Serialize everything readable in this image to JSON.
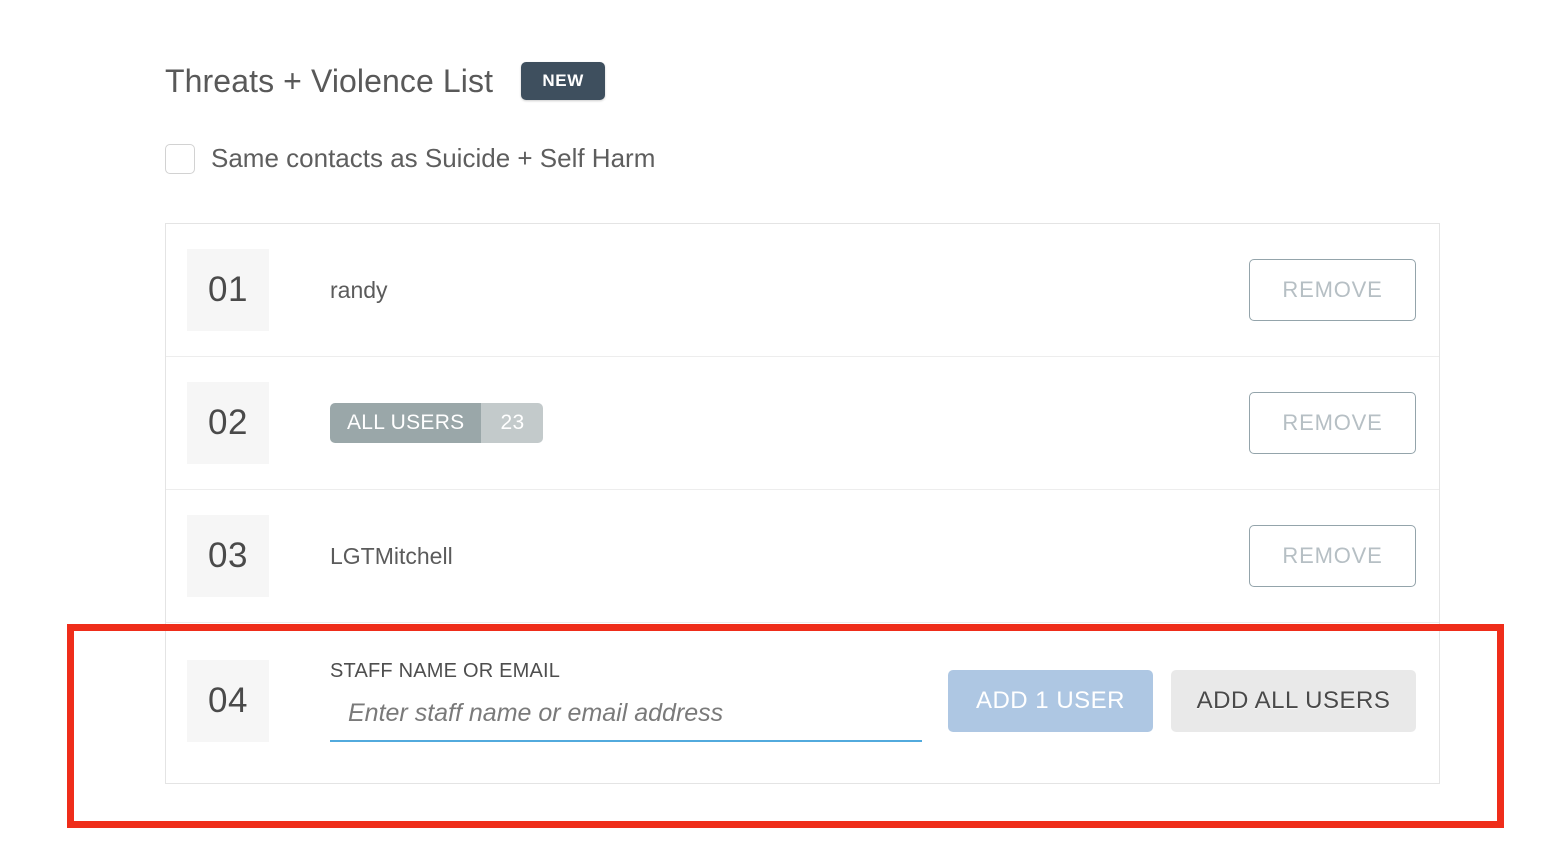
{
  "header": {
    "title": "Threats + Violence List",
    "badge": "NEW"
  },
  "same_contacts": {
    "label": "Same contacts as Suicide + Self Harm",
    "checked": false
  },
  "list": {
    "rows": [
      {
        "index": "01",
        "type": "user",
        "name": "randy",
        "action_label": "REMOVE"
      },
      {
        "index": "02",
        "type": "group",
        "pill_label": "ALL USERS",
        "pill_count": "23",
        "action_label": "REMOVE"
      },
      {
        "index": "03",
        "type": "user",
        "name": "LGTMitchell",
        "action_label": "REMOVE"
      },
      {
        "index": "04",
        "type": "input",
        "field_label": "STAFF NAME OR EMAIL",
        "field_value": "",
        "field_placeholder": "Enter staff name or email address",
        "add_one_label": "ADD 1 USER",
        "add_all_label": "ADD ALL USERS"
      }
    ]
  },
  "colors": {
    "badge_new_bg": "#3e4f5e",
    "remove_border": "#94a4ab",
    "remove_text": "#b6bfc4",
    "add_one_bg": "#aec7e3",
    "add_all_bg": "#e9e9e9",
    "pill_label_bg": "#9aa7a9",
    "pill_count_bg": "#c3cacb",
    "input_underline": "#52aadd",
    "annotation": "#ef2d1a",
    "index_bg": "#f6f6f6"
  }
}
